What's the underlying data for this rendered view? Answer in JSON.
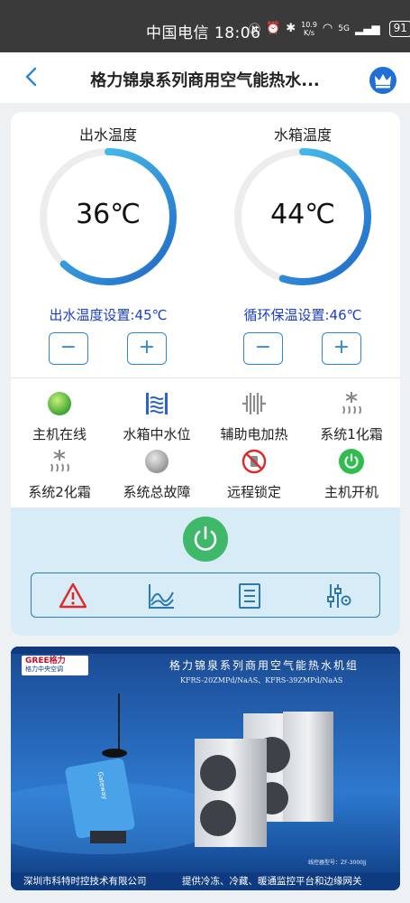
{
  "statusbar": {
    "carrier": "中国电信",
    "time": "18:06",
    "speed_value": "10.9",
    "speed_unit": "K/s",
    "network": "5G",
    "battery": "91"
  },
  "navbar": {
    "title": "格力锦泉系列商用空气能热水..."
  },
  "gauges": [
    {
      "label": "出水温度",
      "value": "36℃",
      "level": 0.62,
      "setting": "出水温度设置:45℃"
    },
    {
      "label": "水箱温度",
      "value": "44℃",
      "level": 0.55,
      "setting": "循环保温设置:46℃"
    }
  ],
  "buttons": {
    "minus": "−",
    "plus": "+"
  },
  "statuses": [
    {
      "label": "主机在线",
      "icon": "green-dot-icon"
    },
    {
      "label": "水箱中水位",
      "icon": "water-level-icon"
    },
    {
      "label": "辅助电加热",
      "icon": "electric-heat-icon"
    },
    {
      "label": "系统1化霜",
      "icon": "defrost-icon"
    },
    {
      "label": "系统2化霜",
      "icon": "defrost-icon"
    },
    {
      "label": "系统总故障",
      "icon": "gray-dot-icon"
    },
    {
      "label": "远程锁定",
      "icon": "remote-lock-icon"
    },
    {
      "label": "主机开机",
      "icon": "power-on-icon"
    }
  ],
  "colors": {
    "accent": "#2f86d8",
    "gauge_start": "#1f66c7",
    "gauge_end": "#4fd2f3",
    "online": "#5cc63d",
    "power": "#3fb86a",
    "warning": "#e02828"
  },
  "ad": {
    "brand": "GREE格力",
    "brand_sub": "格力中央空调",
    "headline": "格力锦泉系列商用空气能热水机组",
    "models": "KFRS-20ZMPd/NaAS、KFRS-39ZMPd/NaAS",
    "device_label": "Gateway",
    "model_tag": "线控器型号：ZF-3000Jj",
    "company": "深圳市科特时控技术有限公司",
    "tagline": "提供冷冻、冷藏、暖通监控平台和边缘网关"
  }
}
